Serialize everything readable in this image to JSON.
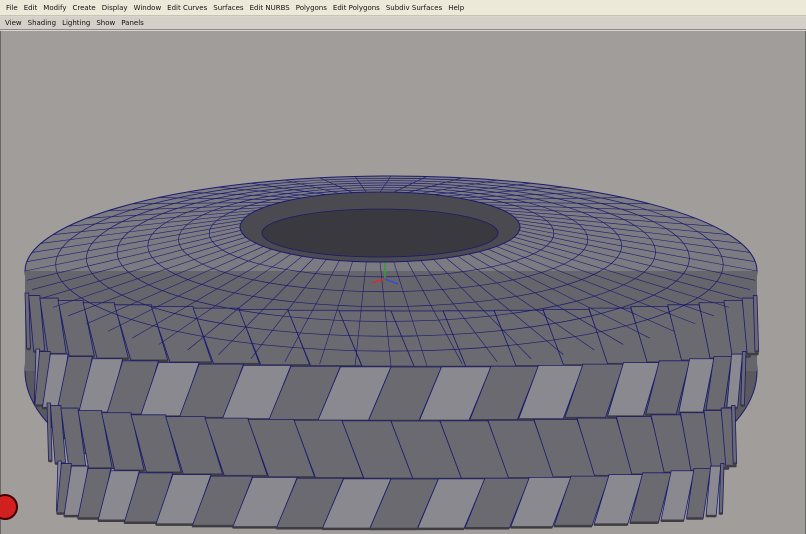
{
  "menubar": {
    "items": [
      "File",
      "Edit",
      "Modify",
      "Create",
      "Display",
      "Window",
      "Edit Curves",
      "Surfaces",
      "Edit NURBS",
      "Polygons",
      "Edit Polygons",
      "Subdiv Surfaces",
      "Help"
    ]
  },
  "panel_menu": {
    "items": [
      "View",
      "Shading",
      "Lighting",
      "Show",
      "Panels"
    ]
  },
  "viewport": {
    "object": "tire-mesh",
    "colors": {
      "background": "#a09d9a",
      "mesh_face": "#6b6a70",
      "mesh_face_light": "#8a898f",
      "mesh_face_dark": "#3e3d44",
      "wireframe": "#1a1a6e",
      "axis_x": "#d03030",
      "axis_y": "#30a030",
      "axis_z": "#3050d0"
    }
  }
}
